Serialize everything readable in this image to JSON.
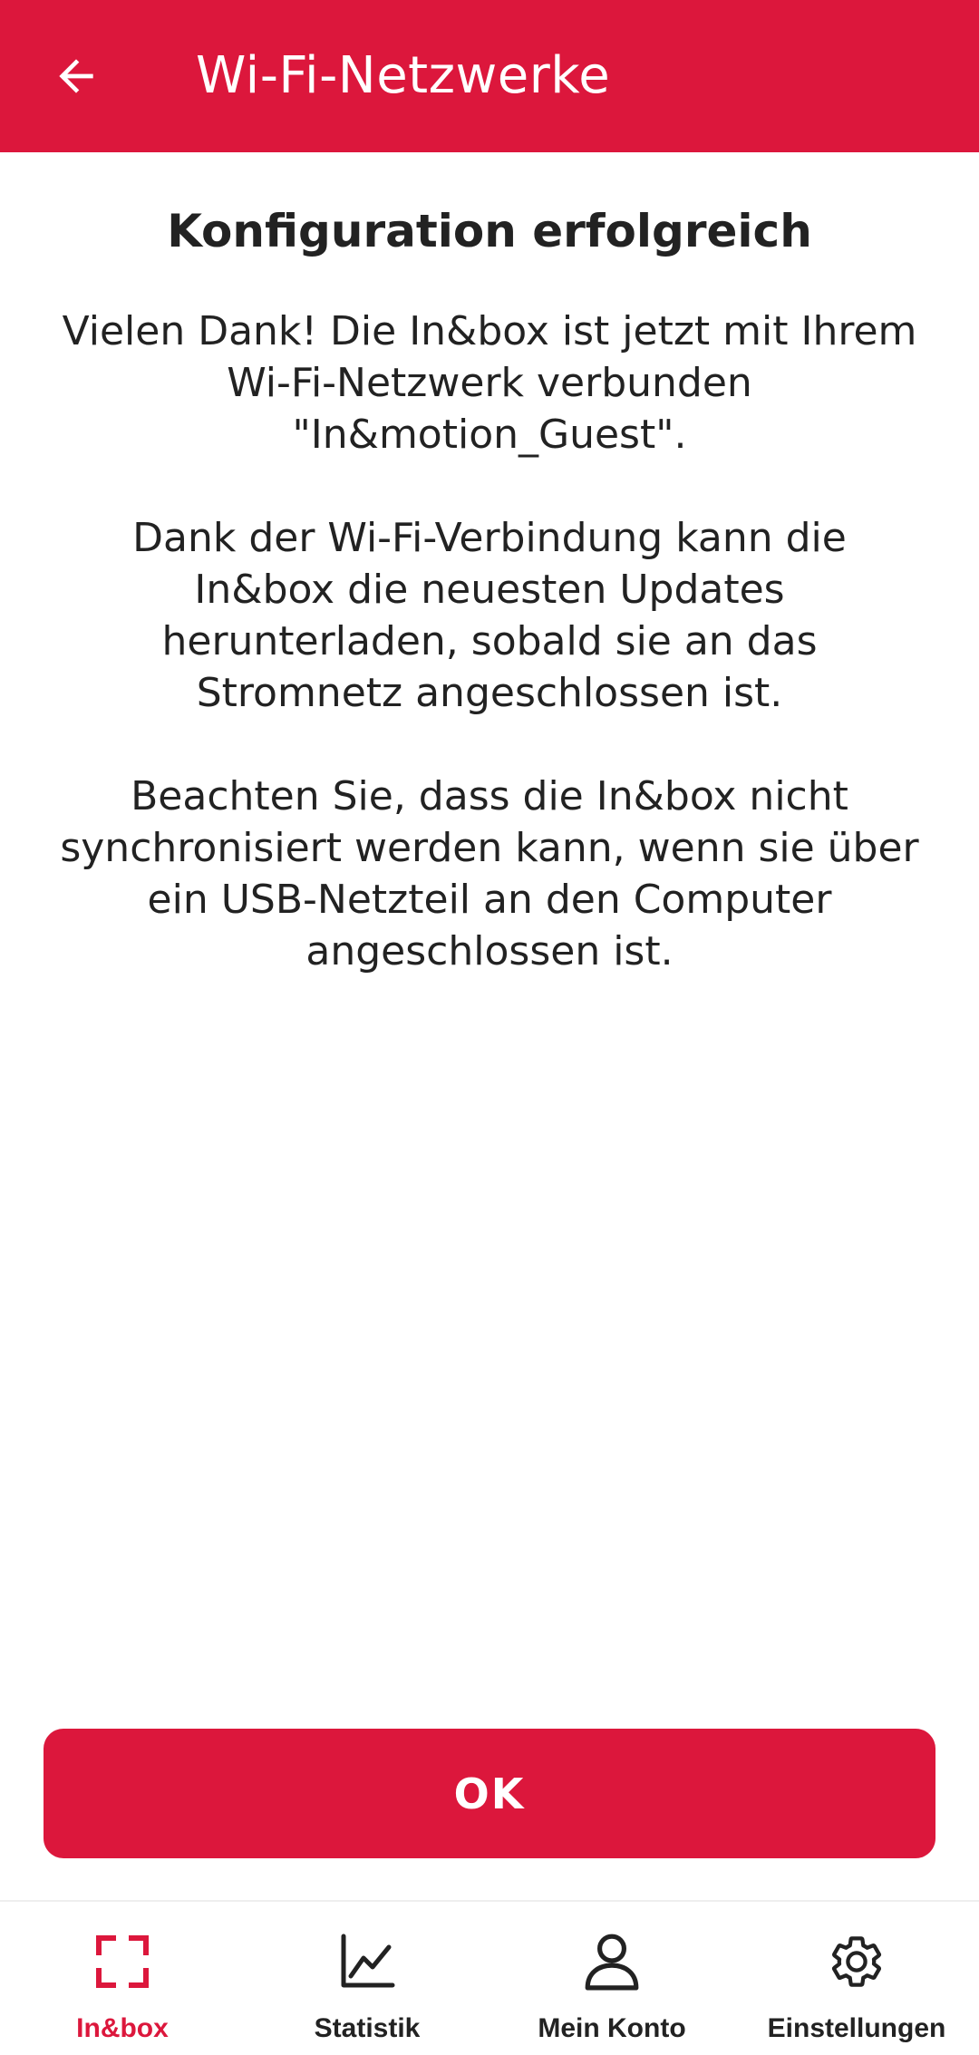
{
  "colors": {
    "brand": "#DC173C",
    "text": "#222222",
    "background": "#FFFFFF"
  },
  "app_bar": {
    "back_icon": "arrow-left-icon",
    "title": "Wi-Fi-Netzwerke"
  },
  "content": {
    "heading": "Konfiguration erfolgreich",
    "paragraph_1": "Vielen Dank! Die In&box ist jetzt mit Ihrem\nWi-Fi-Netzwerk verbunden\n\"In&motion_Guest\".",
    "paragraph_2": "Dank der Wi-Fi-Verbindung kann die\nIn&box die neuesten Updates\nherunterladen, sobald sie an das\nStromnetz angeschlossen ist.",
    "paragraph_3": "Beachten Sie, dass die In&box nicht\nsynchronisiert werden kann, wenn sie über\nein USB-Netzteil an den Computer\nangeschlossen ist."
  },
  "ok_button": {
    "label": "OK"
  },
  "bottom_nav": {
    "items": [
      {
        "label": "In&box",
        "icon": "frame-corners-icon",
        "active": true
      },
      {
        "label": "Statistik",
        "icon": "line-chart-icon",
        "active": false
      },
      {
        "label": "Mein Konto",
        "icon": "user-icon",
        "active": false
      },
      {
        "label": "Einstellungen",
        "icon": "gear-icon",
        "active": false
      }
    ]
  }
}
